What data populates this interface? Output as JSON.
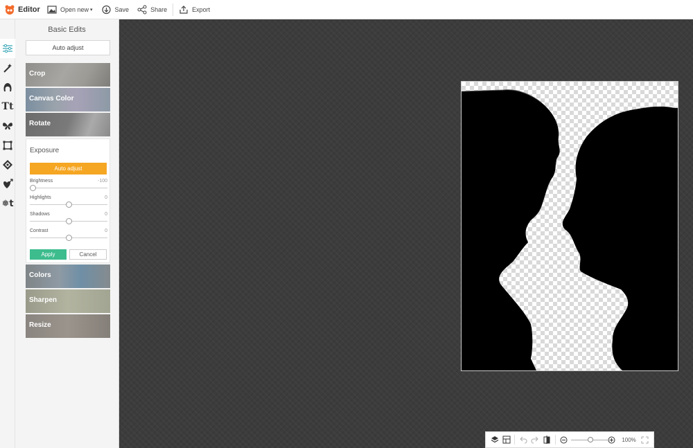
{
  "app": {
    "title": "Editor"
  },
  "toolbar": {
    "open_new_label": "Open new",
    "save_label": "Save",
    "share_label": "Share",
    "export_label": "Export"
  },
  "panel": {
    "title": "Basic Edits",
    "auto_adjust_label": "Auto adjust",
    "tiles_top": [
      {
        "label": "Crop"
      },
      {
        "label": "Canvas Color"
      },
      {
        "label": "Rotate"
      }
    ],
    "exposure": {
      "title": "Exposure",
      "auto_adjust_label": "Auto adjust",
      "sliders": [
        {
          "name": "Brightness",
          "value": "-100",
          "position": 0.0
        },
        {
          "name": "Highlights",
          "value": "0",
          "position": 0.5
        },
        {
          "name": "Shadows",
          "value": "0",
          "position": 0.5
        },
        {
          "name": "Contrast",
          "value": "0",
          "position": 0.5
        }
      ],
      "apply_label": "Apply",
      "cancel_label": "Cancel"
    },
    "tiles_bottom": [
      {
        "label": "Colors"
      },
      {
        "label": "Sharpen"
      },
      {
        "label": "Resize"
      }
    ]
  },
  "rail_icons": [
    "sliders-icon",
    "magic-wand-icon",
    "face-icon",
    "text-icon",
    "butterfly-icon",
    "frame-icon",
    "texture-icon",
    "heart-arrow-icon",
    "design-icon"
  ],
  "bottom": {
    "zoom": "100%",
    "zoom_level": 0.5
  },
  "colors": {
    "accent_orange": "#f5a623",
    "accent_green": "#3dbc8e",
    "canvas_bg": "#3c3c3c"
  }
}
